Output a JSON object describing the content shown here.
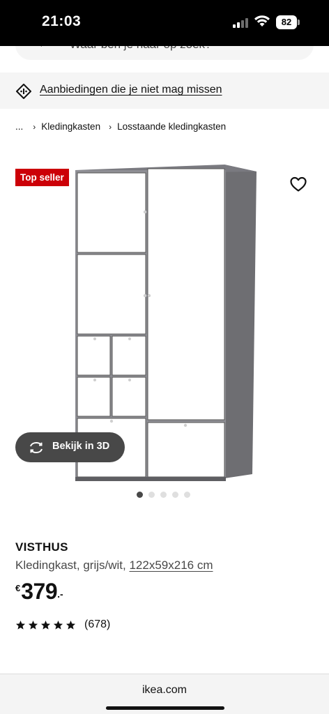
{
  "status_bar": {
    "time": "21:03",
    "battery": "82"
  },
  "search": {
    "placeholder": "Waar ben je naar op zoek?"
  },
  "promo": {
    "link_label": "Aanbiedingen die je niet mag missen"
  },
  "breadcrumb": {
    "ellipsis": "...",
    "items": [
      "Kledingkasten",
      "Losstaande kledingkasten"
    ]
  },
  "gallery": {
    "badge": "Top seller",
    "view3d_label": "Bekijk in 3D",
    "dot_count": 5,
    "active_dot": 1
  },
  "product": {
    "name": "VISTHUS",
    "description": "Kledingkast, grijs/wit,",
    "size": "122x59x216 cm",
    "price_currency": "€",
    "price_value": "379",
    "price_suffix": ".-",
    "rating": 5,
    "rating_max": 5,
    "review_count": "(678)"
  },
  "browser": {
    "domain": "ikea.com"
  },
  "colors": {
    "badge": "#cc0008",
    "pill": "#484848",
    "promo_bg": "#f5f5f5"
  },
  "icons": {
    "wifi": "wifi-icon",
    "signal": "cellular-signal-icon",
    "promo": "price-tag-icon",
    "favorite": "heart-icon",
    "view3d": "rotate-3d-icon",
    "star": "star-icon"
  }
}
